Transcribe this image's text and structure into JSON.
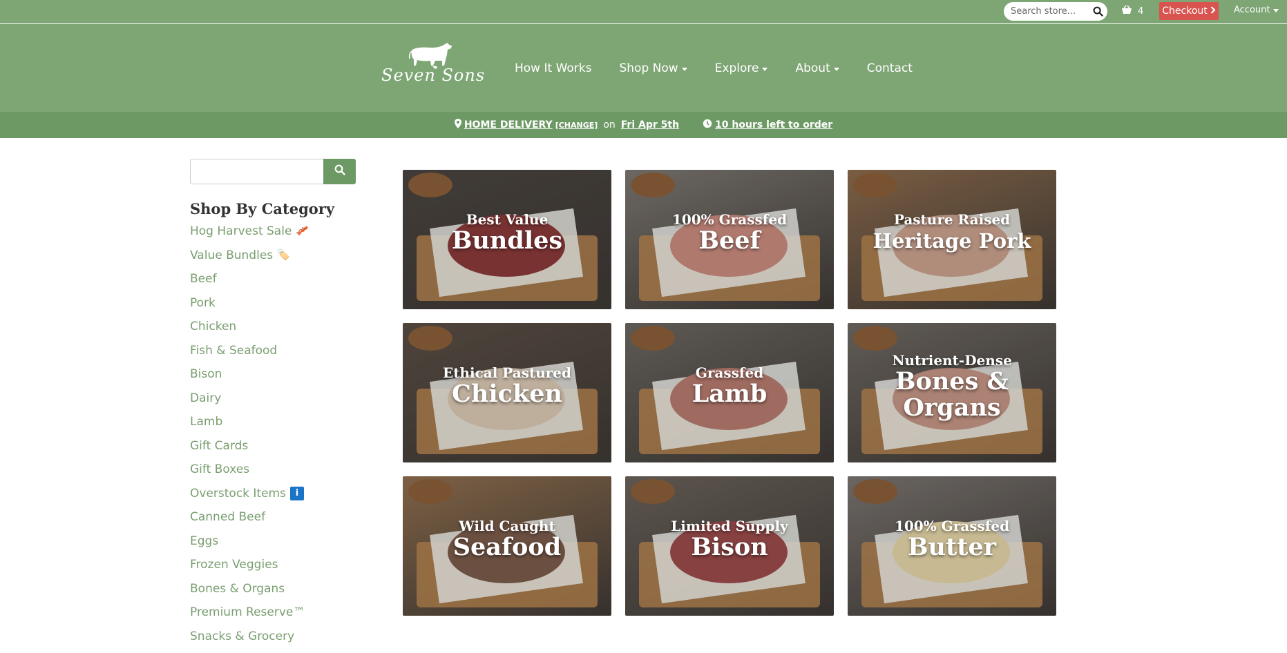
{
  "topbar": {
    "search_placeholder": "Search store...",
    "cart_count": "4",
    "checkout_label": "Checkout",
    "account_label": "Account"
  },
  "header": {
    "logo_text": "Seven Sons",
    "nav": [
      {
        "label": "How It Works",
        "dropdown": false
      },
      {
        "label": "Shop Now",
        "dropdown": true
      },
      {
        "label": "Explore",
        "dropdown": true
      },
      {
        "label": "About",
        "dropdown": true
      },
      {
        "label": "Contact",
        "dropdown": false
      }
    ]
  },
  "delivery": {
    "method": "HOME DELIVERY",
    "change": "[CHANGE]",
    "on": "on",
    "date": "Fri Apr 5th",
    "time_left": "10 hours left to order"
  },
  "sidebar": {
    "title": "Shop By Category",
    "categories": [
      {
        "label": "Hog Harvest Sale",
        "icon": "🥓"
      },
      {
        "label": "Value Bundles",
        "icon": "🏷️"
      },
      {
        "label": "Beef",
        "icon": ""
      },
      {
        "label": "Pork",
        "icon": ""
      },
      {
        "label": "Chicken",
        "icon": ""
      },
      {
        "label": "Fish & Seafood",
        "icon": ""
      },
      {
        "label": "Bison",
        "icon": ""
      },
      {
        "label": "Dairy",
        "icon": ""
      },
      {
        "label": "Lamb",
        "icon": ""
      },
      {
        "label": "Gift Cards",
        "icon": ""
      },
      {
        "label": "Gift Boxes",
        "icon": ""
      },
      {
        "label": "Overstock Items",
        "icon": "i"
      },
      {
        "label": "Canned Beef",
        "icon": ""
      },
      {
        "label": "Eggs",
        "icon": ""
      },
      {
        "label": "Frozen Veggies",
        "icon": ""
      },
      {
        "label": "Bones & Organs",
        "icon": ""
      },
      {
        "label": "Premium Reserve™",
        "icon": ""
      },
      {
        "label": "Snacks & Grocery",
        "icon": ""
      }
    ]
  },
  "tiles": [
    {
      "line1": "Best Value",
      "line2": "Bundles",
      "line3": "",
      "bg": "#4a4440",
      "accent": "#8a3a3a"
    },
    {
      "line1": "100% Grassfed",
      "line2": "Beef",
      "line3": "",
      "bg": "#7b7670",
      "accent": "#c98a7e"
    },
    {
      "line1": "Pasture Raised",
      "line2": "Heritage Pork",
      "line3": "",
      "bg": "#8a6a4c",
      "accent": "#c9a08c"
    },
    {
      "line1": "Ethical Pastured",
      "line2": "Chicken",
      "line3": "",
      "bg": "#5a4e44",
      "accent": "#d9c6b2"
    },
    {
      "line1": "Grassfed",
      "line2": "Lamb",
      "line3": "",
      "bg": "#6a6660",
      "accent": "#b57a6e"
    },
    {
      "line1": "Nutrient-Dense",
      "line2": "Bones &",
      "line3": "Organs",
      "bg": "#6e6862",
      "accent": "#c39584"
    },
    {
      "line1": "Wild Caught",
      "line2": "Seafood",
      "line3": "",
      "bg": "#8f6e4e",
      "accent": "#7a5a4a"
    },
    {
      "line1": "Limited Supply",
      "line2": "Bison",
      "line3": "",
      "bg": "#6a625a",
      "accent": "#9a4a4a"
    },
    {
      "line1": "100% Grassfed",
      "line2": "Butter",
      "line3": "",
      "bg": "#7a7470",
      "accent": "#e3d3a6"
    }
  ]
}
